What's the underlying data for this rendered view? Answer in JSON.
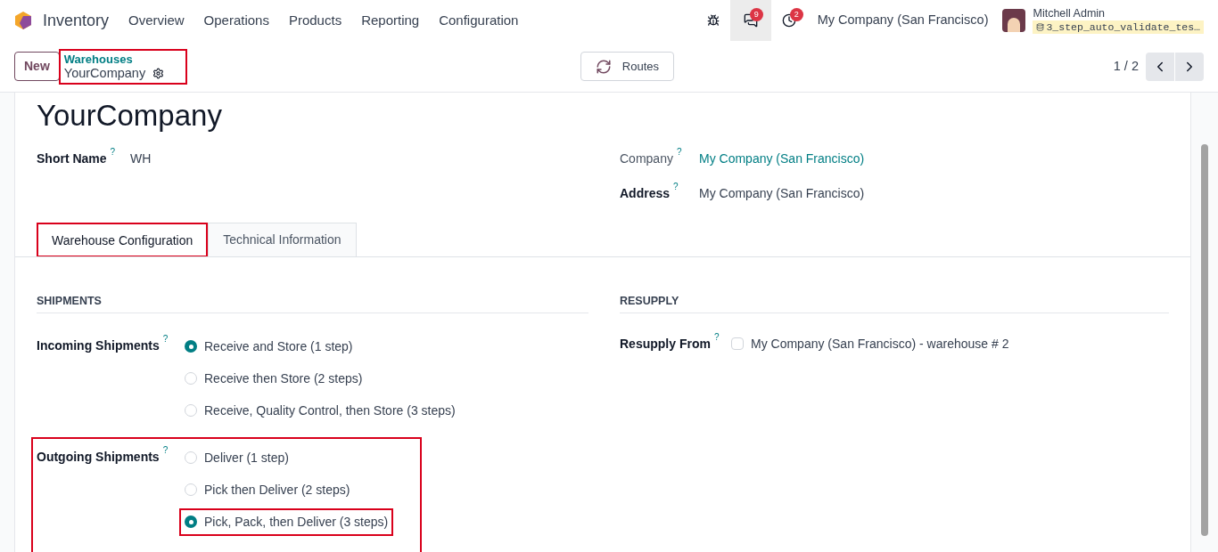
{
  "navbar": {
    "app_name": "Inventory",
    "menu": [
      "Overview",
      "Operations",
      "Products",
      "Reporting",
      "Configuration"
    ],
    "messages_count": "9",
    "activities_count": "2",
    "company": "My Company (San Francisco)",
    "user": "Mitchell Admin",
    "database": "3_step_auto_validate_tes…"
  },
  "control_bar": {
    "new_button": "New",
    "breadcrumb": {
      "parent": "Warehouses",
      "current": "YourCompany",
      "highlighted": true
    },
    "routes_button": "Routes",
    "pager": "1 / 2"
  },
  "form": {
    "title": "YourCompany",
    "left_fields": [
      {
        "label": "Short Name",
        "help": "?",
        "value": "WH",
        "kind": "text"
      }
    ],
    "right_fields": [
      {
        "label": "Company",
        "help": "?",
        "value": "My Company (San Francisco)",
        "kind": "link"
      },
      {
        "label": "Address",
        "help": "?",
        "value": "My Company (San Francisco)",
        "kind": "text"
      }
    ],
    "tabs": [
      {
        "label": "Warehouse Configuration",
        "selected": true,
        "highlighted": true
      },
      {
        "label": "Technical Information",
        "selected": false,
        "highlighted": false
      }
    ],
    "shipments": {
      "heading": "SHIPMENTS",
      "groups": [
        {
          "label": "Incoming Shipments",
          "help": "?",
          "highlighted": false,
          "options": [
            {
              "label": "Receive and Store (1 step)",
              "selected": true,
              "highlighted": false
            },
            {
              "label": "Receive then Store (2 steps)",
              "selected": false,
              "highlighted": false
            },
            {
              "label": "Receive, Quality Control, then Store (3 steps)",
              "selected": false,
              "highlighted": false
            }
          ]
        },
        {
          "label": "Outgoing Shipments",
          "help": "?",
          "highlighted": true,
          "options": [
            {
              "label": "Deliver (1 step)",
              "selected": false,
              "highlighted": false
            },
            {
              "label": "Pick then Deliver (2 steps)",
              "selected": false,
              "highlighted": false
            },
            {
              "label": "Pick, Pack, then Deliver (3 steps)",
              "selected": true,
              "highlighted": true
            }
          ]
        }
      ]
    },
    "resupply": {
      "heading": "RESUPPLY",
      "label": "Resupply From",
      "help": "?",
      "options": [
        {
          "label": "My Company (San Francisco) - warehouse # 2",
          "checked": false
        }
      ]
    }
  }
}
